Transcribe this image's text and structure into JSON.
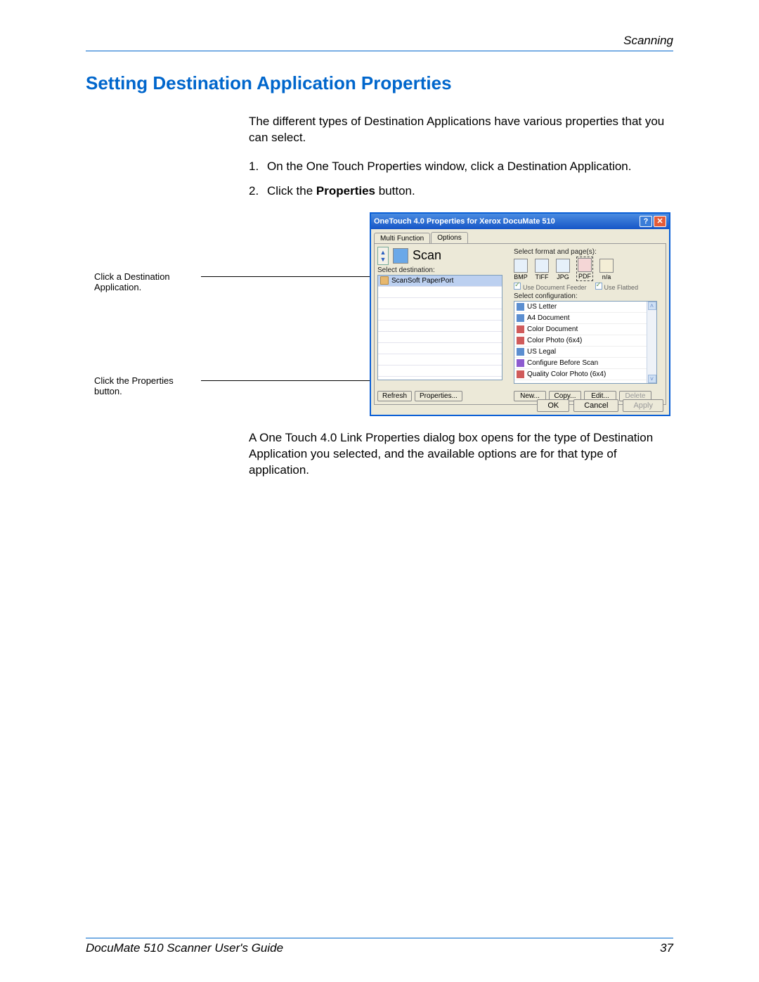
{
  "header": {
    "chapter": "Scanning"
  },
  "section": {
    "title": "Setting Destination Application Properties"
  },
  "intro": "The different types of Destination Applications have various properties that you can select.",
  "steps": [
    {
      "num": "1.",
      "text": "On the One Touch Properties window, click a Destination Application."
    },
    {
      "num": "2.",
      "pre": "Click the ",
      "bold": "Properties",
      "post": " button."
    }
  ],
  "callouts": {
    "dest": "Click a Destination Application.",
    "props": "Click the Properties button."
  },
  "dialog": {
    "title": "OneTouch 4.0 Properties for Xerox DocuMate 510",
    "tabs": {
      "multi": "Multi Function",
      "options": "Options"
    },
    "scan_label": "Scan",
    "select_dest_label": "Select destination:",
    "dest_item": "ScanSoft PaperPort",
    "format_label": "Select format and page(s):",
    "formats": [
      "BMP",
      "TIFF",
      "JPG",
      "PDF",
      "n/a"
    ],
    "use_feeder": "Use Document Feeder",
    "use_flatbed": "Use Flatbed",
    "select_config_label": "Select configuration:",
    "configs": [
      "US Letter",
      "A4 Document",
      "Color Document",
      "Color Photo (6x4)",
      "US Legal",
      "Configure Before Scan",
      "Quality Color Photo (6x4)"
    ],
    "buttons": {
      "refresh": "Refresh",
      "properties": "Properties...",
      "new": "New...",
      "copy": "Copy...",
      "edit": "Edit...",
      "delete": "Delete",
      "ok": "OK",
      "cancel": "Cancel",
      "apply": "Apply"
    }
  },
  "after": "A One Touch 4.0 Link Properties dialog box opens for the type of Destination Application you selected, and the available options are for that type of application.",
  "footer": {
    "guide": "DocuMate 510 Scanner User's Guide",
    "page": "37"
  }
}
